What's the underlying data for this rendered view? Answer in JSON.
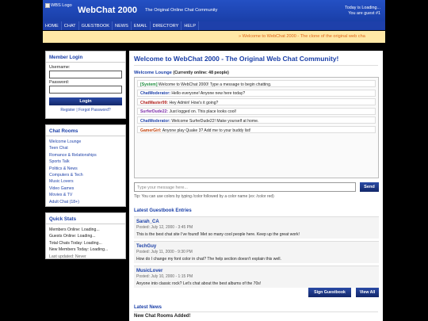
{
  "header": {
    "logo_alt": "WBS Logo",
    "site_title": "WebChat 2000",
    "tagline": "The Original Online Chat Community",
    "status_line1": "Today is Loading...",
    "status_line2": "You are guest #1"
  },
  "nav": [
    "HOME",
    "CHAT",
    "GUESTBOOK",
    "NEWS",
    "EMAIL",
    "DIRECTORY",
    "HELP"
  ],
  "marquee": "» Welcome to WebChat 2000 - The clone of the original web cha",
  "login": {
    "title": "Member Login",
    "username_label": "Username:",
    "password_label": "Password:",
    "button": "Login",
    "register": "Register",
    "separator": "|",
    "forgot": "Forgot Password?"
  },
  "rooms": {
    "title": "Chat Rooms",
    "items": [
      "Welcome Lounge",
      "Teen Chat",
      "Romance & Relationships",
      "Sports Talk",
      "Politics & News",
      "Computers & Tech",
      "Music Lovers",
      "Video Games",
      "Movies & TV",
      "Adult Chat (18+)"
    ]
  },
  "stats": {
    "title": "Quick Stats",
    "members_online": "Members Online: Loading...",
    "guests_online": "Guests Online: Loading...",
    "total_chats": "Total Chats Today: Loading...",
    "new_members": "New Members Today: Loading...",
    "last_updated": "Last updated: Never"
  },
  "main": {
    "welcome_title": "Welcome to WebChat 2000 - The Original Web Chat Community!",
    "lounge_title": "Welcome Lounge",
    "lounge_online": "(Currently online: 48 people)",
    "messages": [
      {
        "user": "[System]",
        "text": " Welcome to WebChat 2000! Type a message to begin chatting.",
        "color": "#1a8a3a"
      },
      {
        "user": "ChatModerator:",
        "text": " Hello everyone! Anyone new here today?",
        "color": "#2244aa"
      },
      {
        "user": "ChatMaster99:",
        "text": " Hey Admin! How's it going?",
        "color": "#b0231f"
      },
      {
        "user": "SurferDude22:",
        "text": " Just logged on. This place looks cool!",
        "color": "#7a2aa8"
      },
      {
        "user": "ChatModerator:",
        "text": " Welcome SurferDude22! Make yourself at home.",
        "color": "#2244aa"
      },
      {
        "user": "GamerGirl:",
        "text": " Anyone play Quake 3? Add me to your buddy list!",
        "color": "#c0400a"
      }
    ],
    "input_placeholder": "Type your message here...",
    "send_label": "Send",
    "tip": "Tip: You can use colors by typing /color followed by a color name (ex: /color red)"
  },
  "guestbook": {
    "title": "Latest Guestbook Entries",
    "entries": [
      {
        "name": "Sarah_CA",
        "date": "Posted: July 12, 2000 - 3:45 PM",
        "text": "This is the best chat site I've found! Met so many cool people here. Keep up the great work!"
      },
      {
        "name": "TechGuy",
        "date": "Posted: July 11, 2000 - 9:30 PM",
        "text": "How do I change my font color in chat? The help section doesn't explain this well."
      },
      {
        "name": "MusicLover",
        "date": "Posted: July 10, 2000 - 1:15 PM",
        "text": "Anyone into classic rock? Let's chat about the best albums of the 70s!"
      }
    ],
    "sign_button": "Sign Guestbook",
    "view_all_button": "View All"
  },
  "news": {
    "title": "Latest News",
    "first_item": "New Chat Rooms Added!"
  }
}
